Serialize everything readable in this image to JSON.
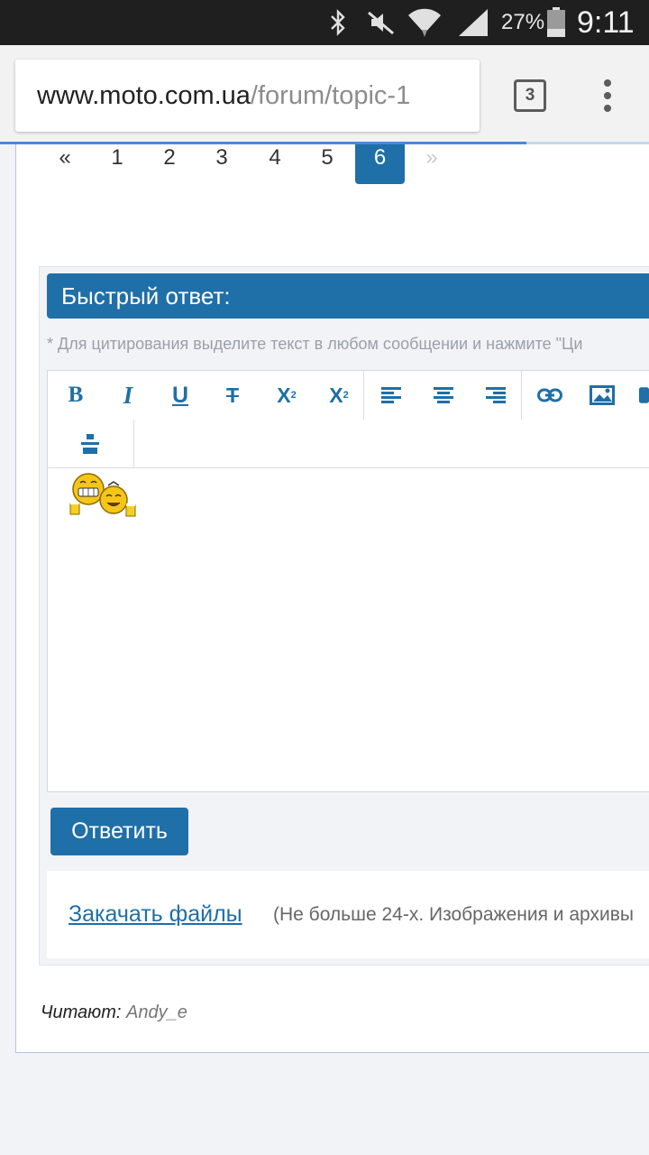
{
  "status_bar": {
    "battery_percent": "27%",
    "time": "9:11",
    "icons": [
      "bluetooth-icon",
      "mute-icon",
      "wifi-icon",
      "cell-signal-icon",
      "battery-icon"
    ]
  },
  "browser": {
    "url_host": "www.moto.com.ua",
    "url_path": "/forum/topic-1",
    "tab_count": "3",
    "menu_icon": "overflow-menu-icon"
  },
  "pagination": {
    "prev": "«",
    "pages": [
      "1",
      "2",
      "3",
      "4",
      "5"
    ],
    "current": "6",
    "next": "»"
  },
  "quick_reply": {
    "title": "Быстрый ответ:",
    "hint": "* Для цитирования выделите текст в любом сообщении и нажмите \"Ци",
    "toolbar": {
      "bold": "B",
      "italic": "I",
      "underline": "U",
      "strike": "T",
      "superscript": "X",
      "subscript": "X",
      "icons": [
        "bold-icon",
        "italic-icon",
        "underline-icon",
        "strikethrough-icon",
        "superscript-icon",
        "subscript-icon",
        "align-left-icon",
        "align-center-icon",
        "align-right-icon",
        "link-icon",
        "image-icon",
        "spoiler-icon"
      ]
    },
    "editor_content": "emoticon-beer-smileys-icon",
    "submit_label": "Ответить",
    "upload_link": "Закачать файлы",
    "upload_note": "(Не больше 24-х. Изображения и архивы"
  },
  "reading": {
    "label": "Читают:",
    "users": "Andy_e"
  },
  "colors": {
    "accent": "#1f6fa8",
    "status_bar": "#1f1f1f",
    "progress": "#4a89dc"
  }
}
